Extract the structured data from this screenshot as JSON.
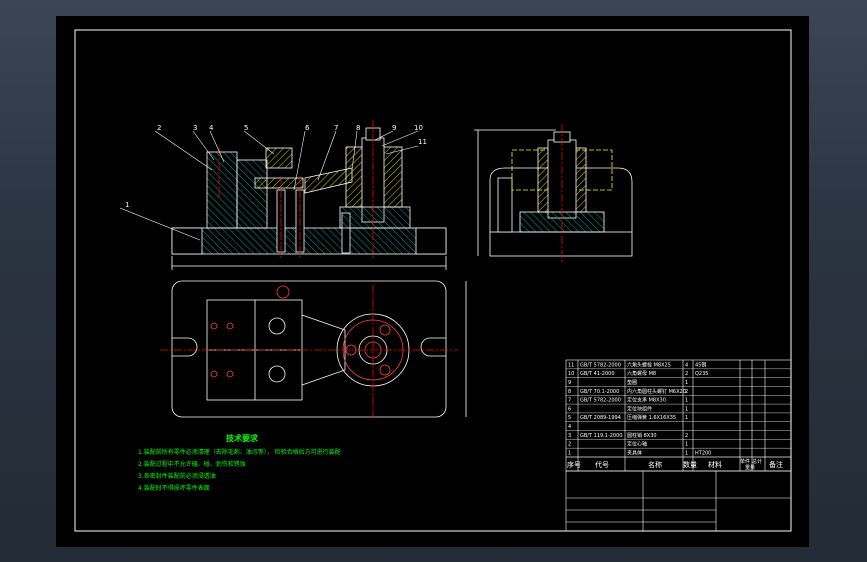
{
  "part_labels": [
    "1",
    "2",
    "3",
    "4",
    "5",
    "6",
    "7",
    "8",
    "9",
    "10",
    "11"
  ],
  "tech_title": "技术要求",
  "tech_notes": [
    "1.装配前所有零件必须清理（去除毛刺、油污等）， 检验合格后方可进行装配",
    "2.装配过程中不允许磕、碰、划伤和锈蚀",
    "3.各密封件装配前必须浸透油",
    "4.装配时不得损坏零件表面"
  ],
  "bom_header": {
    "seq": "序号",
    "code": "代号",
    "name": "名称",
    "qty": "数量",
    "material": "材料",
    "unit_weight": "单件",
    "total_weight": "总计",
    "weight_label": "重量",
    "remark": "备注"
  },
  "bom_rows": [
    {
      "seq": "11",
      "code": "GB/T 5782-2000",
      "name": "六角头螺栓 M8X25",
      "qty": "4",
      "material": "45钢",
      "remark": ""
    },
    {
      "seq": "10",
      "code": "GB/T 41-2000",
      "name": "六角螺母 M8",
      "qty": "2",
      "material": "Q235",
      "remark": ""
    },
    {
      "seq": "9",
      "code": "",
      "name": "垫圈",
      "qty": "1",
      "material": "",
      "remark": ""
    },
    {
      "seq": "8",
      "code": "GB/T 70.1-2000",
      "name": "内六角圆柱头螺钉 M6X20",
      "qty": "2",
      "material": "",
      "remark": ""
    },
    {
      "seq": "7",
      "code": "GB/T 5782-2000",
      "name": "定位支承 M8X30",
      "qty": "1",
      "material": "",
      "remark": ""
    },
    {
      "seq": "6",
      "code": "",
      "name": "定位块组件",
      "qty": "1",
      "material": "",
      "remark": ""
    },
    {
      "seq": "5",
      "code": "GB/T 2089-1994",
      "name": "压缩弹簧 1.6X16X35",
      "qty": "1",
      "material": "",
      "remark": ""
    },
    {
      "seq": "4",
      "code": "",
      "name": "",
      "qty": "",
      "material": "",
      "remark": ""
    },
    {
      "seq": "3",
      "code": "GB/T 119.1-2000",
      "name": "圆柱销 8X30",
      "qty": "2",
      "material": "",
      "remark": ""
    },
    {
      "seq": "2",
      "code": "",
      "name": "定位心轴",
      "qty": "1",
      "material": "",
      "remark": ""
    },
    {
      "seq": "1",
      "code": "",
      "name": "夹具体",
      "qty": "1",
      "material": "HT200",
      "remark": ""
    }
  ],
  "colors": {
    "sheet": "#000000",
    "line": "#ffffff",
    "section": "#ffff00",
    "center": "#ff0000",
    "note": "#00ff00",
    "hatch": "#00a0a0"
  }
}
